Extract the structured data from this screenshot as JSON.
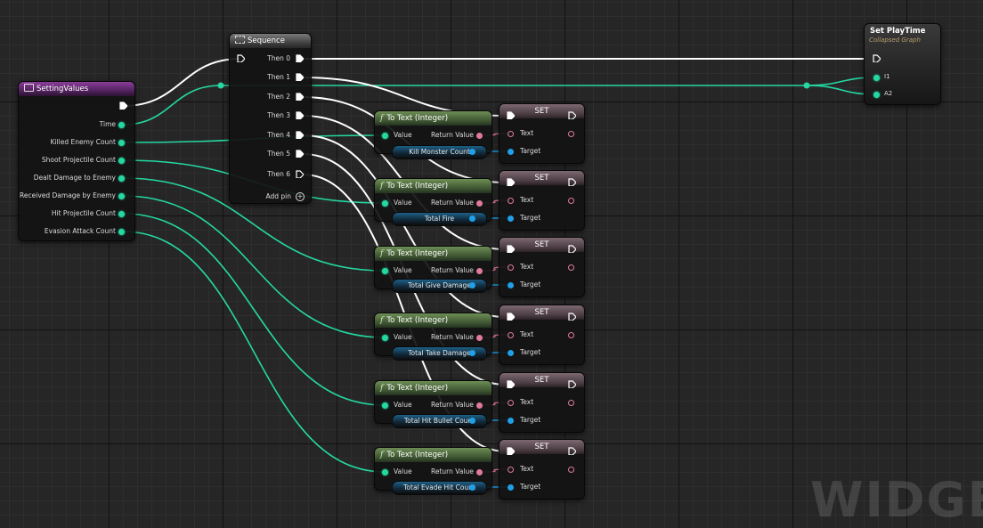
{
  "nodes": {
    "setting_values": {
      "title": "SettingValues",
      "pins": [
        "Time",
        "Killed Enemy Count",
        "Shoot Projectile Count",
        "Dealt Damage to Enemy",
        "Received Damage by Enemy",
        "Hit Projectile Count",
        "Evasion Attack Count"
      ]
    },
    "sequence": {
      "title": "Sequence",
      "pins": [
        "Then 0",
        "Then 1",
        "Then 2",
        "Then 3",
        "Then 4",
        "Then 5",
        "Then 6"
      ],
      "add_pin": "Add pin"
    },
    "set_playtime": {
      "title": "Set PlayTime",
      "subtitle": "Collapsed Graph",
      "pins": [
        "I1",
        "A2"
      ]
    },
    "to_text_title": "To Text (Integer)",
    "to_text_value_label": "Value",
    "to_text_return_label": "Return Value",
    "set_title": "SET",
    "set_text_label": "Text",
    "set_target_label": "Target",
    "variables": [
      "Kill Monster Count",
      "Total Fire",
      "Total Give Damage",
      "Total Take Damage",
      "Total Hit Bullet Count",
      "Total Evade Hit Count"
    ]
  },
  "watermark": "WIDGET",
  "colors": {
    "wire_exec": "#ffffff",
    "wire_int": "#25d8a2",
    "wire_text": "#e07b9a",
    "wire_object": "#1fa0e8",
    "header_event": "#6a2f78",
    "header_function": "#4d6b3c",
    "header_set": "#5a4a50"
  }
}
